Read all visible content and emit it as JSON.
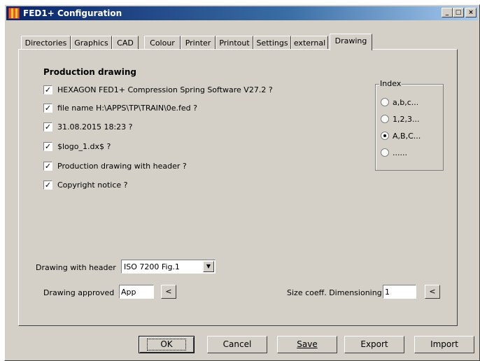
{
  "window": {
    "title": "FED1+ Configuration",
    "minimize_glyph": "_",
    "maximize_glyph": "□",
    "close_glyph": "×"
  },
  "tabs": [
    {
      "label": "Directories"
    },
    {
      "label": "Graphics"
    },
    {
      "label": "CAD"
    },
    {
      "label": "Colour"
    },
    {
      "label": "Printer"
    },
    {
      "label": "Printout"
    },
    {
      "label": "Settings"
    },
    {
      "label": "external"
    },
    {
      "label": "Drawing",
      "active": true
    }
  ],
  "production": {
    "title": "Production drawing",
    "checkboxes": [
      {
        "label": "HEXAGON FED1+  Compression Spring Software V27.2 ?",
        "checked": true
      },
      {
        "label": "file name H:\\APPS\\TP\\TRAIN\\0e.fed ?",
        "checked": true
      },
      {
        "label": "31.08.2015 18:23 ?",
        "checked": true
      },
      {
        "label": "$logo_1.dx$ ?",
        "checked": true
      },
      {
        "label": "Production drawing with header ?",
        "checked": true
      },
      {
        "label": "Copyright notice ?",
        "checked": true
      }
    ],
    "check_glyph": "✓"
  },
  "index": {
    "title": "Index",
    "options": [
      {
        "label": "a,b,c...",
        "selected": false
      },
      {
        "label": "1,2,3...",
        "selected": false
      },
      {
        "label": "A,B,C...",
        "selected": true
      },
      {
        "label": "......",
        "selected": false
      }
    ]
  },
  "header_select": {
    "label": "Drawing with header",
    "value": "ISO 7200 Fig.1",
    "arrow_glyph": "▼"
  },
  "approved": {
    "label": "Drawing approved",
    "value": "App",
    "button_label": "<"
  },
  "size_coeff": {
    "label": "Size coeff. Dimensioning",
    "value": "1",
    "button_label": "<"
  },
  "buttons": {
    "ok": "OK",
    "cancel": "Cancel",
    "save": "Save",
    "export": "Export",
    "import": "Import"
  }
}
